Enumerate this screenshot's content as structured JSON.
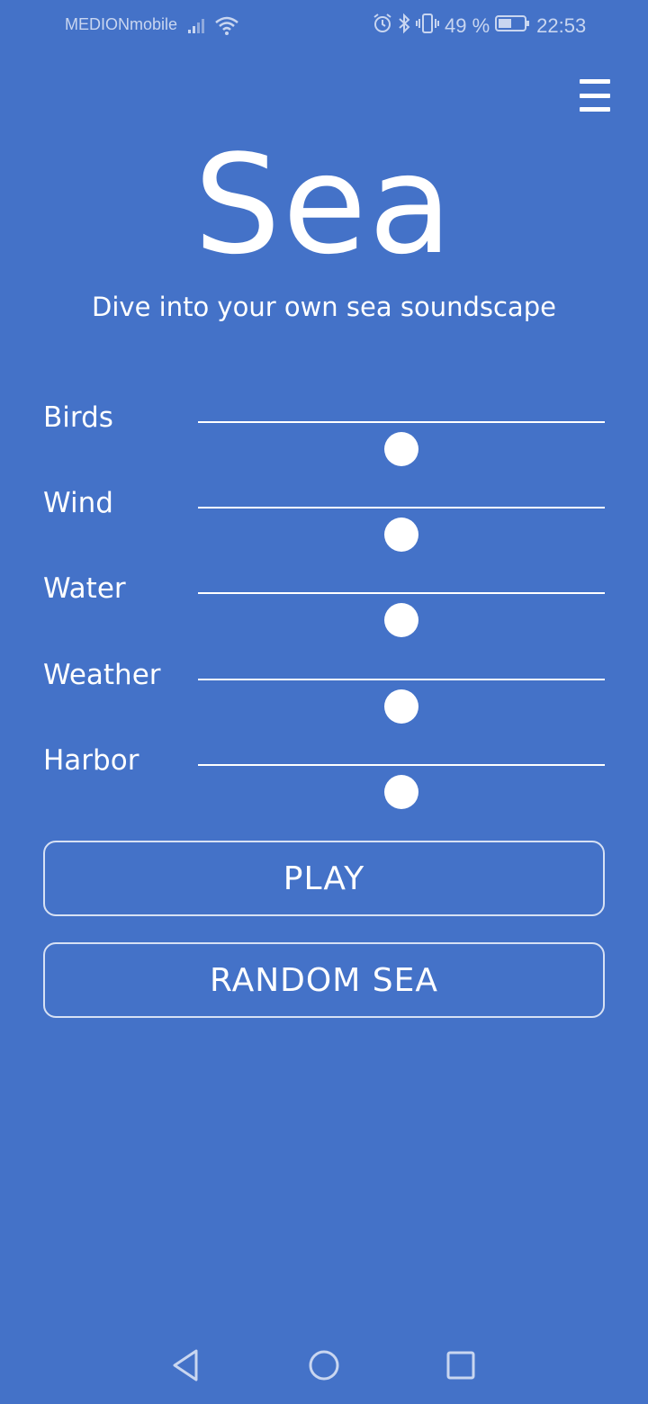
{
  "status_bar": {
    "carrier": "MEDIONmobile",
    "battery_percent": "49 %",
    "time": "22:53",
    "icons": [
      "signal-icon",
      "wifi-icon",
      "alarm-icon",
      "bluetooth-icon",
      "vibrate-icon",
      "battery-icon"
    ]
  },
  "header": {
    "menu_icon": "hamburger-menu-icon",
    "title": "Sea",
    "subtitle": "Dive into your own sea soundscape"
  },
  "sliders": [
    {
      "label": "Birds",
      "value": 0.5
    },
    {
      "label": "Wind",
      "value": 0.5
    },
    {
      "label": "Water",
      "value": 0.5
    },
    {
      "label": "Weather",
      "value": 0.5
    },
    {
      "label": "Harbor",
      "value": 0.5
    }
  ],
  "buttons": {
    "play": "PLAY",
    "random": "RANDOM SEA"
  },
  "nav": {
    "icons": [
      "back-icon",
      "home-icon",
      "recents-icon"
    ]
  },
  "colors": {
    "background": "#4472c8",
    "foreground": "#ffffff"
  }
}
